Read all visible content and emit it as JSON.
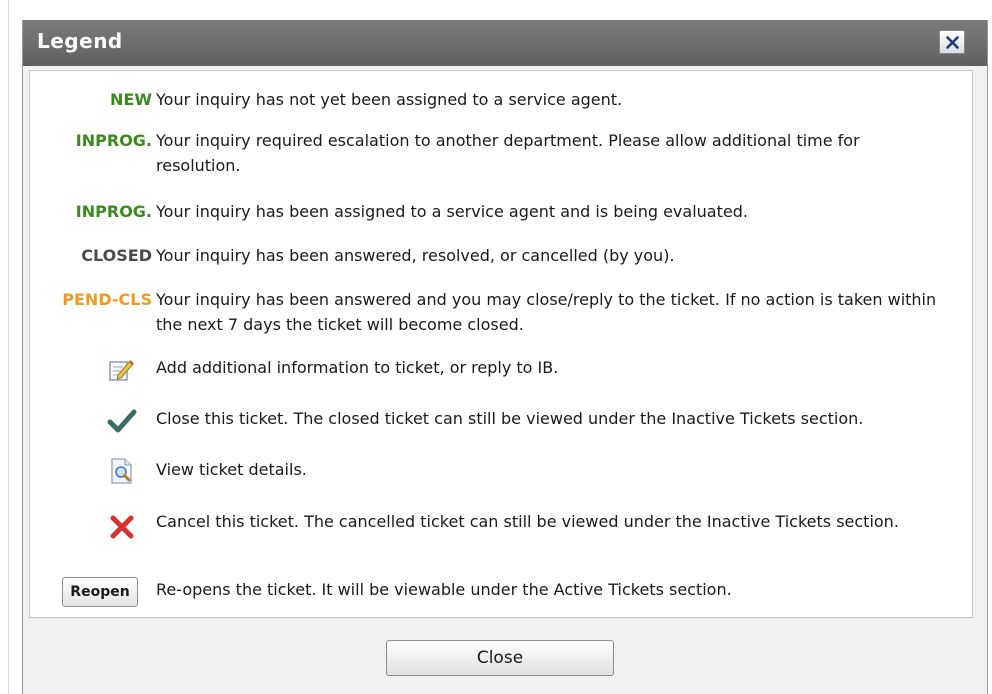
{
  "dialog": {
    "title": "Legend",
    "close_icon": "close-icon",
    "close_button_label": "Close"
  },
  "legend": {
    "status_rows": [
      {
        "key": "NEW",
        "color": "#3a8a1d",
        "text": "Your inquiry has not yet been assigned to a service agent."
      },
      {
        "key": "INPROG.",
        "color": "#3a8a1d",
        "text": "Your inquiry required escalation to another department. Please allow additional time for resolution."
      },
      {
        "key": "INPROG.",
        "color": "#3a8a1d",
        "text": "Your inquiry has been assigned to a service agent and is being evaluated."
      },
      {
        "key": "CLOSED",
        "color": "#4a4a4a",
        "text": "Your inquiry has been answered, resolved, or cancelled (by you)."
      },
      {
        "key": "PEND-CLS",
        "color": "#f29a1d",
        "text": "Your inquiry has been answered and you may close/reply to the ticket. If no action is taken within the next 7 days the ticket will become closed."
      }
    ],
    "icon_rows": [
      {
        "icon": "edit-icon",
        "text": "Add additional information to ticket, or reply to IB."
      },
      {
        "icon": "checkmark-icon",
        "text": "Close this ticket. The closed ticket can still be viewed under the Inactive Tickets section."
      },
      {
        "icon": "view-details-icon",
        "text": "View ticket details."
      },
      {
        "icon": "cancel-x-icon",
        "text": "Cancel this ticket. The cancelled ticket can still be viewed under the Inactive Tickets section."
      }
    ],
    "reopen_row": {
      "button_label": "Reopen",
      "text": "Re-opens the ticket. It will be viewable under the Active Tickets section."
    }
  }
}
